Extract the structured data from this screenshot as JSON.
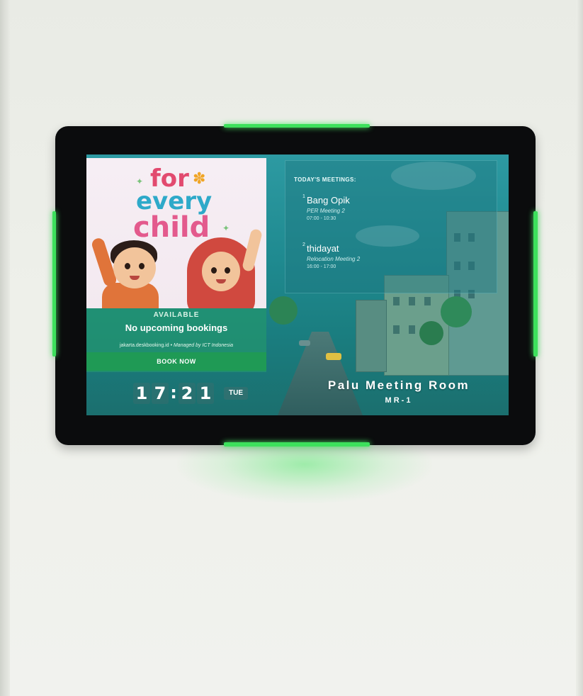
{
  "poster": {
    "line1": "for",
    "line2": "every",
    "line3": "child"
  },
  "status": {
    "label": "AVAILABLE",
    "text": "No upcoming bookings"
  },
  "footer": {
    "site": "jakarta.deskbooking.id",
    "separator": "•",
    "managed_by": "Managed by ICT Indonesia"
  },
  "book_button": {
    "label": "BOOK NOW"
  },
  "meetings": {
    "title": "TODAY'S MEETINGS:",
    "items": [
      {
        "index": "1",
        "host": "Bang Opik",
        "title": "PER Meeting 2",
        "time": "07:00 - 10:30"
      },
      {
        "index": "2",
        "host": "thidayat",
        "title": "Relocation Meeting 2",
        "time": "16:00 - 17:00"
      }
    ]
  },
  "clock": {
    "h1": "1",
    "h2": "7",
    "colon": ":",
    "m1": "2",
    "m2": "1",
    "day": "TUE"
  },
  "room": {
    "name": "Palu Meeting Room",
    "code": "MR-1"
  },
  "colors": {
    "led": "#3de05c",
    "available": "#1f9a55",
    "bezel": "#0b0c0d"
  }
}
